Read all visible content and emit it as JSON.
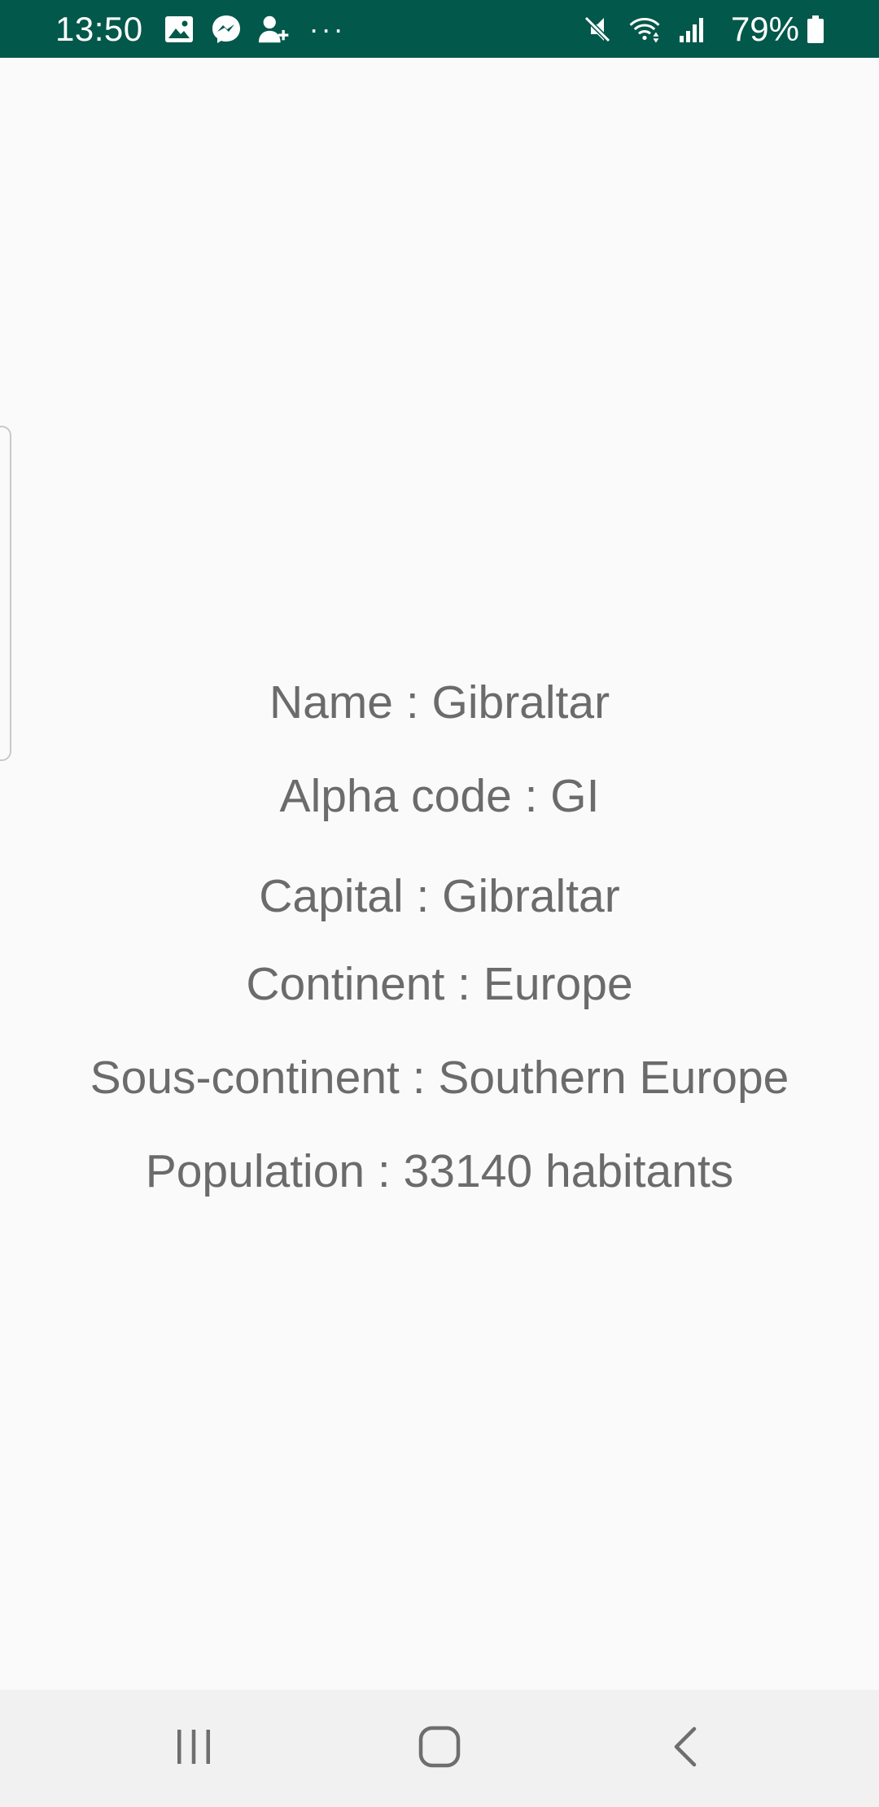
{
  "status_bar": {
    "time": "13:50",
    "battery_percent": "79%",
    "background_color": "#02584a",
    "left_icons": [
      "gallery-icon",
      "messenger-icon",
      "add-contact-icon",
      "more-dots-icon"
    ],
    "more_dots": "···",
    "right_icons": [
      "mute-icon",
      "wifi-icon",
      "signal-icon",
      "battery-icon"
    ]
  },
  "country": {
    "name": "Name : Gibraltar",
    "alpha_code": "Alpha code : GI",
    "capital": "Capital : Gibraltar",
    "continent": "Continent : Europe",
    "subcontinent": "Sous-continent : Southern Europe",
    "population": "Population : 33140 habitants"
  },
  "nav_bar": {
    "buttons": [
      "recents-icon",
      "home-icon",
      "back-icon"
    ]
  }
}
